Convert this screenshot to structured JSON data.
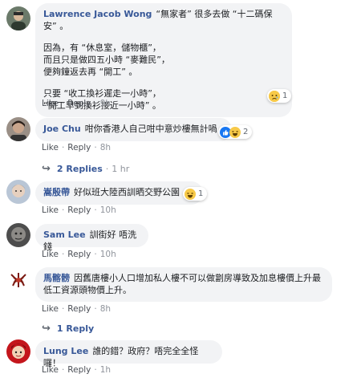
{
  "comments": [
    {
      "author": "Lawrence Jacob Wong",
      "head": "“無家者” 很多去做 “十二碼保安” 。",
      "paragraph1": "因為，有 “休息室，儲物櫃”，\n而且只是做四五小時 “麥難民”，\n便夠鐘返去再 “開工” 。",
      "paragraph2": "只要 “收工換衫遲走一小時”，\n“開工早到換衫接近一小時” 。",
      "like": "Like",
      "reply": "Reply",
      "time": "9h",
      "reaction_count": "1",
      "reaction_icon": "sad-emoji-icon"
    },
    {
      "author": "Joe Chu",
      "text": "咁你香港人自己咁中意炒樓無計喎",
      "like": "Like",
      "reply": "Reply",
      "time": "8h",
      "reaction_count": "2",
      "reaction_icons": [
        "thumbs-up-icon",
        "laugh-emoji-icon"
      ],
      "replies_label": "2 Replies",
      "replies_time": "1 hr"
    },
    {
      "author": "嵩殷帶",
      "text": "好似班大陸西訓晒交野公園",
      "like": "Like",
      "reply": "Reply",
      "time": "10h",
      "reaction_count": "1",
      "reaction_icon": "laugh-emoji-icon"
    },
    {
      "author": "Sam Lee",
      "text": "訓街好 唔洗錢",
      "like": "Like",
      "reply": "Reply",
      "time": "10h"
    },
    {
      "author": "馬髂髈",
      "text": "因舊唐樓小人口增加私人樓不可以做劏房導致及加息樓價上升最低工資源頭物價上升。",
      "like": "Like",
      "reply": "Reply",
      "time": "8h",
      "replies_label": "1 Reply"
    },
    {
      "author": "Lung Lee",
      "text": "誰的錯？政府？唔完全全怪囉！",
      "like": "Like",
      "reply": "Reply",
      "time": "1h"
    }
  ],
  "colors": {
    "author": "#385898",
    "bubble": "#f2f3f5",
    "meta": "#90949c",
    "like_blue": "#1877f2",
    "emoji_yellow": "#f7c948"
  }
}
